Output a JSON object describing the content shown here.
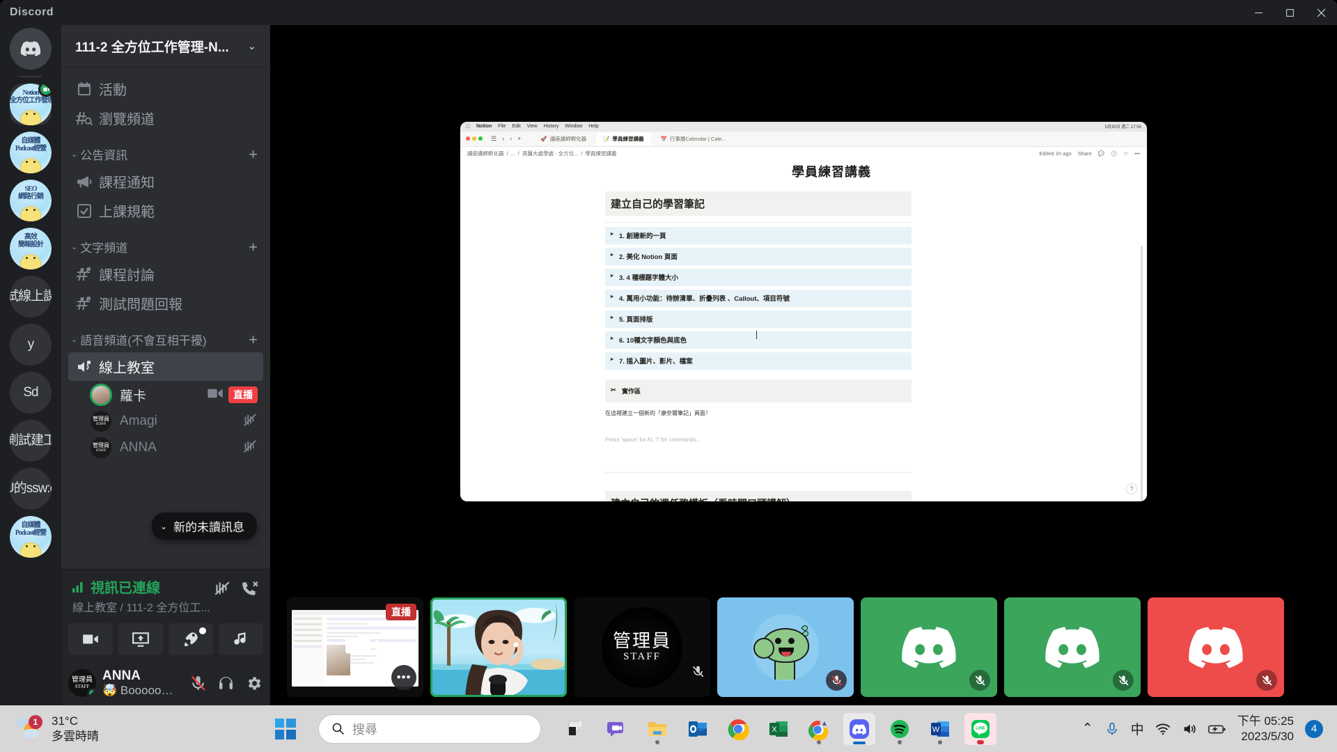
{
  "window": {
    "app_name": "Discord",
    "controls": {
      "minimize": "—",
      "maximize": "▢",
      "close": "✕"
    }
  },
  "guild_rail": {
    "home_label": "Discord",
    "servers": [
      {
        "name": "Notion 全方位工作管理",
        "line1": "Notion",
        "line2": "全方位工作管理",
        "type": "chick",
        "active": true,
        "video_badge": true
      },
      {
        "name": "自媒體 Podcast經營",
        "line1": "自媒體",
        "line2": "Podcast經營",
        "type": "chick",
        "active": false
      },
      {
        "name": "SEO 網路行銷",
        "line1": "SEO",
        "line2": "網路行銷",
        "type": "chick",
        "active": false
      },
      {
        "name": "高效簡報設計",
        "line1": "高效",
        "line2": "簡報設計",
        "type": "chick",
        "active": false
      },
      {
        "name": "試線上課",
        "initials": "試線上課",
        "type": "text",
        "active": false
      },
      {
        "name": "y",
        "initials": "y",
        "type": "text",
        "active": false
      },
      {
        "name": "Sd",
        "initials": "Sd",
        "type": "text",
        "active": false
      },
      {
        "name": "測試建立",
        "initials": "測試建工",
        "type": "text",
        "active": false
      },
      {
        "name": "U的ssw:o",
        "initials": "U的ssw:o",
        "type": "text",
        "active": false
      },
      {
        "name": "自媒體 Podcast經營 2",
        "line1": "自媒體",
        "line2": "Podcast經營",
        "type": "chick",
        "active": false
      }
    ]
  },
  "sidebar": {
    "server_name": "111-2 全方位工作管理-N...",
    "top_items": [
      {
        "label": "活動",
        "icon": "calendar-icon"
      },
      {
        "label": "瀏覽頻道",
        "icon": "browse-channels-icon"
      }
    ],
    "categories": [
      {
        "label": "公告資訊",
        "channels": [
          {
            "label": "課程通知",
            "icon": "announcement-channel-icon"
          },
          {
            "label": "上課規範",
            "icon": "rules-channel-icon"
          }
        ]
      },
      {
        "label": "文字頻道",
        "channels": [
          {
            "label": "課程討論",
            "icon": "text-channel-locked-icon"
          },
          {
            "label": "測試問題回報",
            "icon": "text-channel-locked-icon"
          }
        ]
      },
      {
        "label": "語音頻道(不會互相干擾)",
        "channels": [
          {
            "label": "線上教室",
            "icon": "voice-channel-locked-icon",
            "selected": true
          }
        ]
      }
    ],
    "voice_members": [
      {
        "name": "蘿卡",
        "speaking": true,
        "has_video": true,
        "live": "直播",
        "avatar_type": "photo"
      },
      {
        "name": "Amagi",
        "speaking": false,
        "muted": true,
        "avatar_type": "staff"
      },
      {
        "name": "ANNA",
        "speaking": false,
        "muted": true,
        "avatar_type": "staff"
      }
    ],
    "unread_jump": {
      "label": "新的未讀訊息"
    }
  },
  "voice_panel": {
    "status": "視訊已連線",
    "route": "線上教室 / 111-2 全方位工作管理工...",
    "route_display": "線上教室 / 111-2 全方位工...",
    "actions": [
      {
        "name": "noise-suppression-button",
        "icon": "noise-cancel-icon"
      },
      {
        "name": "disconnect-button",
        "icon": "phone-hangup-icon"
      }
    ],
    "buttons": [
      {
        "name": "camera-button",
        "icon": "camera-icon"
      },
      {
        "name": "share-screen-button",
        "icon": "screen-share-icon"
      },
      {
        "name": "activities-button",
        "icon": "rocket-icon",
        "badge": true
      },
      {
        "name": "soundboard-button",
        "icon": "soundboard-icon"
      }
    ]
  },
  "user_panel": {
    "username": "ANNA",
    "status_text": "🤯 Booooom!!!",
    "status_emoji": "🤯",
    "status_label": "Booooom!!!",
    "presence": "online",
    "avatar_line1": "管理員",
    "avatar_line2": "STAFF",
    "controls": [
      {
        "name": "mute-button",
        "icon": "mic-muted-icon"
      },
      {
        "name": "deafen-button",
        "icon": "headphones-icon"
      },
      {
        "name": "user-settings-button",
        "icon": "gear-icon"
      }
    ]
  },
  "screenshare": {
    "os_menubar": {
      "apple": "",
      "items": [
        "Notion",
        "File",
        "Edit",
        "View",
        "History",
        "Window",
        "Help"
      ],
      "clock": "5月30日 週二 17:56"
    },
    "tabs": [
      {
        "label": "講座講師孵化器",
        "icon": "rocket-doc-icon",
        "active": false
      },
      {
        "label": "學員練習講義",
        "icon": "note-doc-icon",
        "active": true
      },
      {
        "label": "行事曆Calendar | Cale...",
        "icon": "calendar-doc-icon",
        "active": false
      }
    ],
    "breadcrumb": [
      "講座講師孵化器",
      "...",
      "高醫大處學處 - 全方位...",
      "學員練習講義"
    ],
    "header_right": {
      "edited": "Edited 1h ago",
      "share": "Share",
      "icons": [
        "comment-icon",
        "clock-icon",
        "star-icon",
        "more-icon"
      ]
    },
    "page_title": "學員練習講義",
    "heading_1": "建立自己的學習筆記",
    "toggles": [
      "1. 創建新的一頁",
      "2. 美化 Notion 頁面",
      "3. 4 種標題字體大小",
      "4. 萬用小功能：待辦清單、折疊列表 、Callout、項目符號",
      "5. 頁面排版",
      "6. 10種文字顏色與底色",
      "7. 插入圖片、影片、檔案"
    ],
    "callout": "實作區",
    "paragraph": "在這裡建立一個新的「康奈爾筆記」頁面！",
    "placeholder": "Press 'space' for AI, '/' for commands...",
    "heading_2": "建立自己的週任務模板（看時間口頭講解）",
    "help_button": "?"
  },
  "tiles": [
    {
      "name": "screenshare-tile",
      "type": "share",
      "badge": "直播",
      "more": "•••"
    },
    {
      "name": "camera-tile",
      "type": "camera",
      "speaking": true
    },
    {
      "name": "staff-tile",
      "type": "staff",
      "line1": "管理員",
      "line2": "STAFF",
      "muted": true
    },
    {
      "name": "dino-avatar-tile",
      "type": "dino",
      "bg": "#7bc3ec",
      "muted": true
    },
    {
      "name": "discord-avatar-tile-1",
      "type": "discord",
      "bg": "#3ba55c",
      "muted": true
    },
    {
      "name": "discord-avatar-tile-2",
      "type": "discord",
      "bg": "#3ba55c",
      "muted": true
    },
    {
      "name": "discord-avatar-tile-3",
      "type": "discord",
      "bg": "#ee4b4b",
      "muted": true
    }
  ],
  "taskbar": {
    "weather": {
      "temperature": "31°C",
      "condition": "多雲時晴",
      "badge": "1"
    },
    "search_placeholder": "搜尋",
    "apps": [
      {
        "name": "taskbar-app-lenovo",
        "label": "Lenovo"
      },
      {
        "name": "taskbar-app-teams",
        "label": "Microsoft Teams"
      },
      {
        "name": "taskbar-app-file-explorer",
        "label": "檔案總管",
        "running": true
      },
      {
        "name": "taskbar-app-outlook",
        "label": "Outlook"
      },
      {
        "name": "taskbar-app-chrome",
        "label": "Google Chrome"
      },
      {
        "name": "taskbar-app-excel",
        "label": "Excel"
      },
      {
        "name": "taskbar-app-chrome-2",
        "label": "Chrome 2",
        "running": true
      },
      {
        "name": "taskbar-app-discord",
        "label": "Discord",
        "active": true
      },
      {
        "name": "taskbar-app-spotify",
        "label": "Spotify",
        "running": true
      },
      {
        "name": "taskbar-app-word",
        "label": "Word",
        "running": true
      },
      {
        "name": "taskbar-app-line",
        "label": "LINE",
        "active": true
      }
    ],
    "tray": {
      "chevron": "⌃",
      "mic": "mic-icon",
      "ime": "中",
      "wifi": "wifi-icon",
      "volume": "volume-icon",
      "battery": "battery-icon"
    },
    "clock": {
      "time": "下午 05:25",
      "date": "2023/5/30"
    },
    "notification_count": "4"
  }
}
